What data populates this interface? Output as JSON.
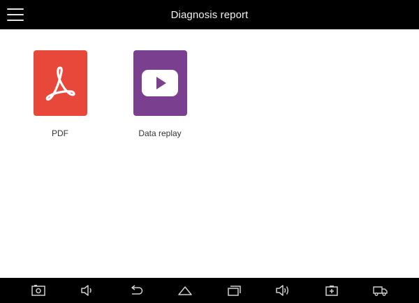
{
  "header": {
    "title": "Diagnosis report",
    "menu_icon": "hamburger-menu-icon",
    "background": "#000000"
  },
  "tiles": [
    {
      "label": "PDF",
      "icon": "pdf-acrobat-icon",
      "color": "#e8483a"
    },
    {
      "label": "Data replay",
      "icon": "play-video-icon",
      "color": "#7b3f8f"
    }
  ],
  "navbar": {
    "buttons": [
      {
        "name": "screenshot-icon"
      },
      {
        "name": "volume-down-icon"
      },
      {
        "name": "back-icon"
      },
      {
        "name": "home-icon"
      },
      {
        "name": "recent-apps-icon"
      },
      {
        "name": "volume-up-icon"
      },
      {
        "name": "battery-icon"
      },
      {
        "name": "vci-truck-icon"
      }
    ]
  }
}
